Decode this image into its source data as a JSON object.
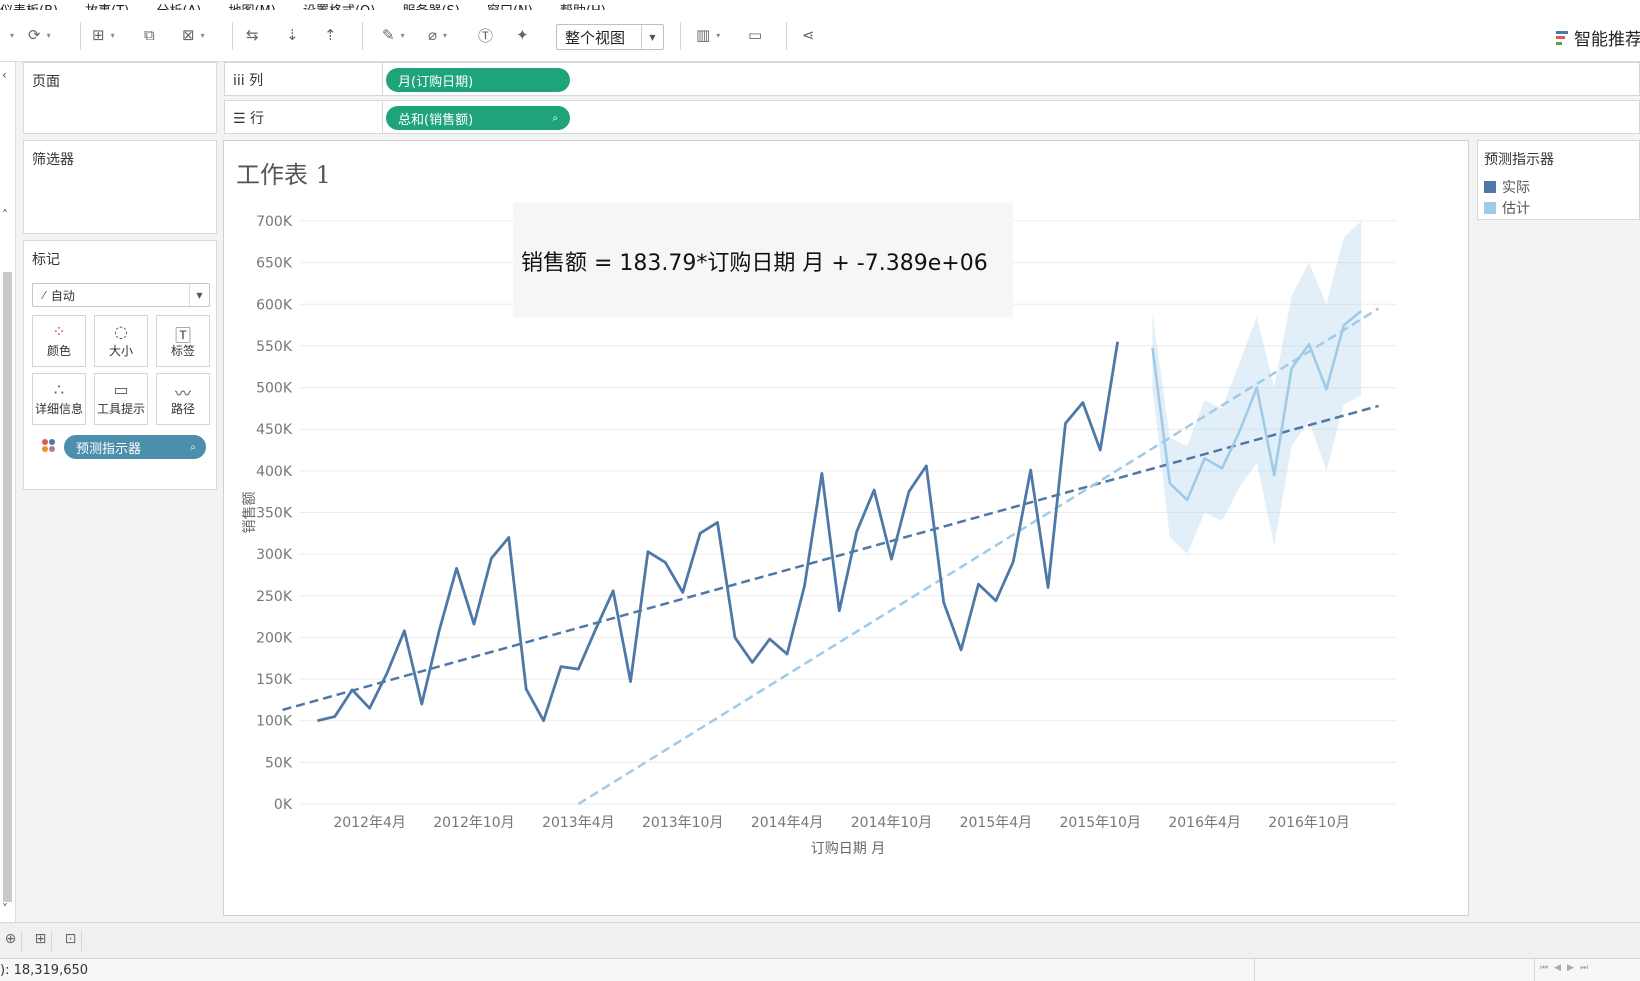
{
  "toolbar": {
    "view_select": "整个视图",
    "smart_recommend": "智能推荐",
    "icons": [
      "undo-icon",
      "redo-icon",
      "new-datasource-icon",
      "duplicate-sheet-icon",
      "clear-sheet-icon",
      "swap-icon",
      "sort-asc-icon",
      "sort-desc-icon",
      "highlight-icon",
      "group-icon",
      "label-icon",
      "pin-icon",
      "show-me-icon",
      "presentation-icon",
      "share-icon"
    ]
  },
  "left_panel": {
    "pages_title": "页面",
    "filters_title": "筛选器",
    "marks_title": "标记",
    "marks_type": "自动",
    "mark_buttons": [
      "颜色",
      "大小",
      "标签",
      "详细信息",
      "工具提示",
      "路径"
    ],
    "marks_pill": "预测指示器"
  },
  "shelves": {
    "columns_label": "列",
    "columns_pill": "月(订购日期)",
    "rows_label": "行",
    "rows_pill": "总和(销售额)"
  },
  "sheet": {
    "title": "工作表 1",
    "annotation": "销售额 = 183.79*订购日期 月 + -7.389e+06"
  },
  "legend": {
    "title": "预测指示器",
    "items": [
      {
        "label": "实际",
        "color": "#4e79a7"
      },
      {
        "label": "估计",
        "color": "#a0cbe8"
      }
    ]
  },
  "status": {
    "sum_text": "): 18,319,650"
  },
  "chart_data": {
    "type": "line",
    "xlabel": "订购日期 月",
    "ylabel": "销售额",
    "x_ticks": [
      "2012年4月",
      "2012年10月",
      "2013年4月",
      "2013年10月",
      "2014年4月",
      "2014年10月",
      "2015年4月",
      "2015年10月",
      "2016年4月",
      "2016年10月"
    ],
    "y_ticks": [
      "0K",
      "50K",
      "100K",
      "150K",
      "200K",
      "250K",
      "300K",
      "350K",
      "400K",
      "450K",
      "500K",
      "550K",
      "600K",
      "650K",
      "700K"
    ],
    "ylim": [
      0,
      700000
    ],
    "series": [
      {
        "name": "实际",
        "color": "#4e79a7",
        "x": [
          "2012-01",
          "2012-02",
          "2012-03",
          "2012-04",
          "2012-05",
          "2012-06",
          "2012-07",
          "2012-08",
          "2012-09",
          "2012-10",
          "2012-11",
          "2012-12",
          "2013-01",
          "2013-02",
          "2013-03",
          "2013-04",
          "2013-05",
          "2013-06",
          "2013-07",
          "2013-08",
          "2013-09",
          "2013-10",
          "2013-11",
          "2013-12",
          "2014-01",
          "2014-02",
          "2014-03",
          "2014-04",
          "2014-05",
          "2014-06",
          "2014-07",
          "2014-08",
          "2014-09",
          "2014-10",
          "2014-11",
          "2014-12",
          "2015-01",
          "2015-02",
          "2015-03",
          "2015-04",
          "2015-05",
          "2015-06",
          "2015-07",
          "2015-08",
          "2015-09",
          "2015-10",
          "2015-11",
          "2015-12"
        ],
        "values": [
          100000,
          105000,
          137000,
          115000,
          157000,
          208000,
          120000,
          208000,
          283000,
          216000,
          295000,
          320000,
          138000,
          100000,
          165000,
          162000,
          210000,
          256000,
          147000,
          303000,
          290000,
          254000,
          325000,
          338000,
          200000,
          170000,
          198000,
          180000,
          262000,
          397000,
          232000,
          327000,
          377000,
          294000,
          375000,
          406000,
          242000,
          185000,
          264000,
          244000,
          291000,
          401000,
          260000,
          457000,
          482000,
          425000,
          555000,
          null
        ]
      },
      {
        "name": "估计",
        "color": "#a0cbe8",
        "x": [
          "2016-01",
          "2016-02",
          "2016-03",
          "2016-04",
          "2016-05",
          "2016-06",
          "2016-07",
          "2016-08",
          "2016-09",
          "2016-10",
          "2016-11",
          "2016-12",
          "2017-01",
          "2017-02"
        ],
        "values": [
          548000,
          385000,
          365000,
          415000,
          403000,
          447000,
          500000,
          395000,
          523000,
          552000,
          498000,
          575000,
          592000,
          null
        ],
        "band_upper": [
          590000,
          440000,
          430000,
          485000,
          475000,
          530000,
          585000,
          500000,
          610000,
          650000,
          600000,
          680000,
          700000,
          null
        ],
        "band_lower": [
          500000,
          320000,
          300000,
          350000,
          340000,
          380000,
          410000,
          310000,
          430000,
          460000,
          400000,
          480000,
          490000,
          null
        ]
      }
    ],
    "trend_lines": [
      {
        "series": "实际",
        "style": "dashed",
        "equation": "销售额 = 183.79*订购日期 月 + -7.389e+06",
        "start": [
          "2011-11",
          113000
        ],
        "end": [
          "2017-02",
          478000
        ]
      },
      {
        "series": "估计",
        "style": "dashed",
        "start": [
          "2013-04",
          0
        ],
        "end": [
          "2017-02",
          595000
        ]
      }
    ],
    "legend": "right"
  }
}
